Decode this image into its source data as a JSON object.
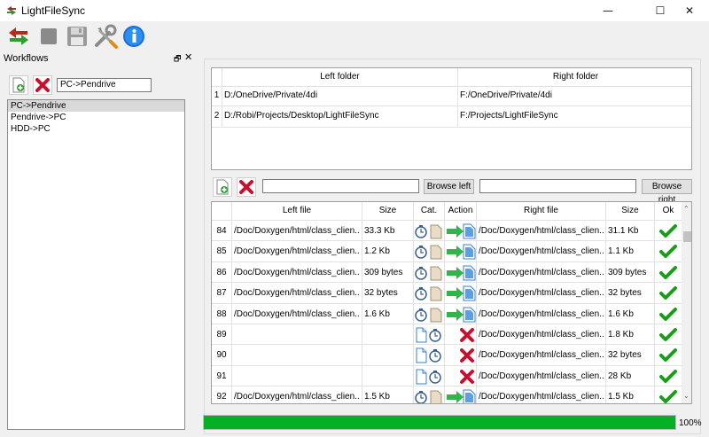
{
  "window": {
    "title": "LightFileSync",
    "min_glyph": "—",
    "max_glyph": "☐",
    "close_glyph": "✕"
  },
  "toolbar": {
    "buttons": [
      {
        "name": "sync-icon"
      },
      {
        "name": "stop-icon"
      },
      {
        "name": "save-icon"
      },
      {
        "name": "settings-tools-icon"
      },
      {
        "name": "info-icon"
      }
    ]
  },
  "workflows": {
    "title": "Workflows",
    "float_glyph": "🗗",
    "close_glyph": "✕",
    "name_value": "PC->Pendrive",
    "items": [
      "PC->Pendrive",
      "Pendrive->PC",
      "HDD->PC"
    ],
    "selected_index": 0
  },
  "folders": {
    "headers": [
      "Left folder",
      "Right folder"
    ],
    "rows": [
      {
        "num": "1",
        "left": "D:/OneDrive/Private/4di",
        "right": "F:/OneDrive/Private/4di"
      },
      {
        "num": "2",
        "left": "D:/Robi/Projects/Desktop/LightFileSync",
        "right": "F:/Projects/LightFileSync"
      }
    ]
  },
  "folder_edit": {
    "left_value": "",
    "right_value": "",
    "browse_left": "Browse left",
    "browse_right": "Browse right"
  },
  "files": {
    "headers": [
      "Left file",
      "Size",
      "Cat.",
      "Action",
      "Right file",
      "Size",
      "Ok"
    ],
    "rows": [
      {
        "num": "84",
        "left": "/Doc/Doxygen/html/class_clien...",
        "lsize": "33.3 Kb",
        "action": "copy",
        "right": "/Doc/Doxygen/html/class_clien...",
        "rsize": "31.1 Kb",
        "ok": true
      },
      {
        "num": "85",
        "left": "/Doc/Doxygen/html/class_clien...",
        "lsize": "1.2 Kb",
        "action": "copy",
        "right": "/Doc/Doxygen/html/class_clien...",
        "rsize": "1.1 Kb",
        "ok": true
      },
      {
        "num": "86",
        "left": "/Doc/Doxygen/html/class_clien...",
        "lsize": "309 bytes",
        "action": "copy",
        "right": "/Doc/Doxygen/html/class_clien...",
        "rsize": "309 bytes",
        "ok": true
      },
      {
        "num": "87",
        "left": "/Doc/Doxygen/html/class_clien...",
        "lsize": "32 bytes",
        "action": "copy",
        "right": "/Doc/Doxygen/html/class_clien...",
        "rsize": "32 bytes",
        "ok": true
      },
      {
        "num": "88",
        "left": "/Doc/Doxygen/html/class_clien...",
        "lsize": "1.6 Kb",
        "action": "copy",
        "right": "/Doc/Doxygen/html/class_clien...",
        "rsize": "1.6 Kb",
        "ok": true
      },
      {
        "num": "89",
        "left": "",
        "lsize": "",
        "action": "delete",
        "right": "/Doc/Doxygen/html/class_clien...",
        "rsize": "1.8 Kb",
        "ok": true
      },
      {
        "num": "90",
        "left": "",
        "lsize": "",
        "action": "delete",
        "right": "/Doc/Doxygen/html/class_clien...",
        "rsize": "32 bytes",
        "ok": true
      },
      {
        "num": "91",
        "left": "",
        "lsize": "",
        "action": "delete",
        "right": "/Doc/Doxygen/html/class_clien...",
        "rsize": "28 Kb",
        "ok": true
      },
      {
        "num": "92",
        "left": "/Doc/Doxygen/html/class_clien...",
        "lsize": "1.5 Kb",
        "action": "copy",
        "right": "/Doc/Doxygen/html/class_clien...",
        "rsize": "1.5 Kb",
        "ok": true
      }
    ]
  },
  "progress": {
    "value": 100,
    "text": "100%"
  },
  "colors": {
    "progress": "#06b025",
    "check": "#1a9e1a",
    "delete": "#c8102e",
    "arrow_green": "#33b44a",
    "doc_blue": "#3a7fd0"
  }
}
